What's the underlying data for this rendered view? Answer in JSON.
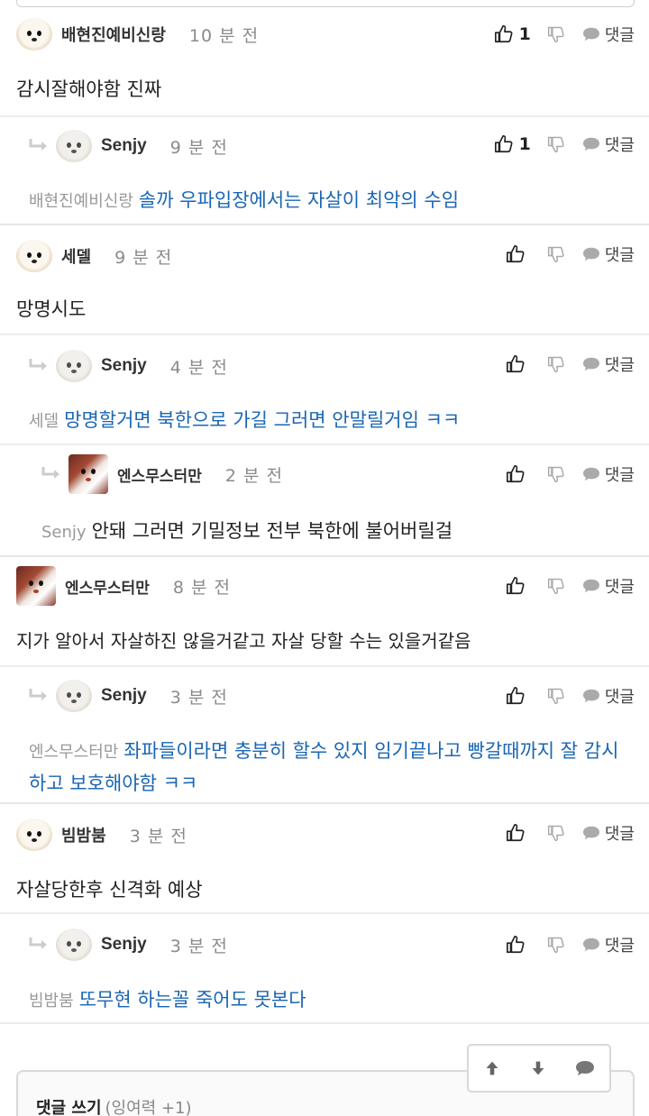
{
  "labels": {
    "reply": "댓글"
  },
  "comments": [
    {
      "author": "배현진예비신랑",
      "time": "10 분 전",
      "likes": "1",
      "text": "감시잘해야함 진짜"
    },
    {
      "author": "Senjy",
      "time": "9 분 전",
      "likes": "1",
      "mention": "배현진예비신랑",
      "text": "솔까 우파입장에서는 자살이 최악의 수임"
    },
    {
      "author": "세델",
      "time": "9 분 전",
      "likes": "",
      "text": "망명시도"
    },
    {
      "author": "Senjy",
      "time": "4 분 전",
      "likes": "",
      "mention": "세델",
      "text": "망명할거면 북한으로 가길 그러면 안말릴거임 ㅋㅋ"
    },
    {
      "author": "엔스무스터만",
      "time": "2 분 전",
      "likes": "",
      "mention": "Senjy",
      "text": "안돼 그러면 기밀정보 전부 북한에 불어버릴걸"
    },
    {
      "author": "엔스무스터만",
      "time": "8 분 전",
      "likes": "",
      "text": "지가 알아서 자살하진 않을거같고 자살 당할 수는 있을거같음"
    },
    {
      "author": "Senjy",
      "time": "3 분 전",
      "likes": "",
      "mention": "엔스무스터만",
      "text": "좌파들이라면 충분히 할수 있지 임기끝나고 빵갈때까지 잘 감시하고 보호해야함 ㅋㅋ"
    },
    {
      "author": "빔밤붐",
      "time": "3 분 전",
      "likes": "",
      "text": "자살당한후 신격화 예상"
    },
    {
      "author": "Senjy",
      "time": "3 분 전",
      "likes": "",
      "mention": "빔밤붐",
      "text": "또무현 하는꼴 죽어도 못본다"
    }
  ],
  "write": {
    "title": "댓글 쓰기",
    "sub": "(잉여력 +1)"
  },
  "icons": [
    "thumbs-up-icon",
    "thumbs-down-icon",
    "speech-bubble-icon",
    "reply-arrow-icon",
    "arrow-up-icon",
    "arrow-down-icon"
  ]
}
